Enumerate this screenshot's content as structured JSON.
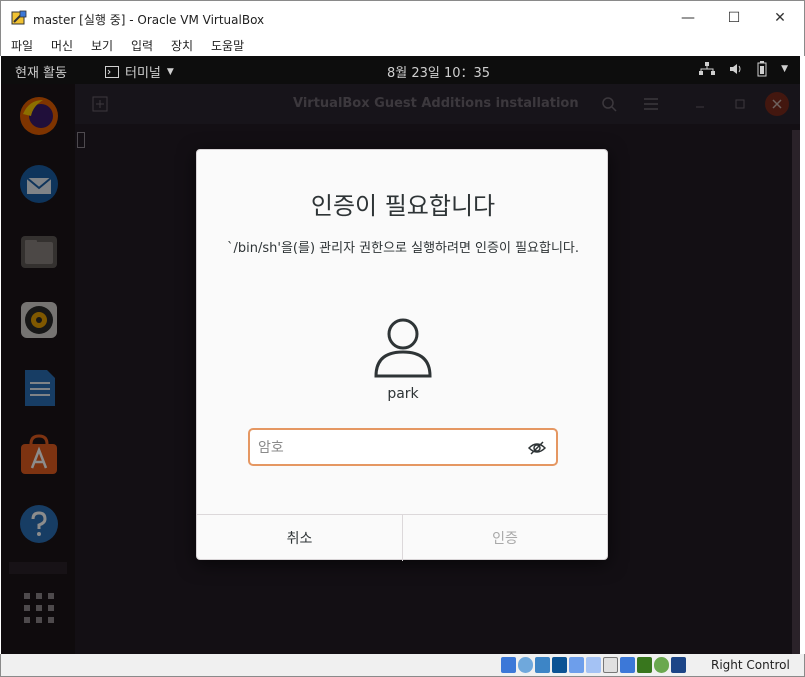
{
  "host": {
    "title": "master [실행 중] - Oracle VM VirtualBox",
    "menu": [
      "파일",
      "머신",
      "보기",
      "입력",
      "장치",
      "도움말"
    ],
    "minimize_glyph": "—",
    "maximize_glyph": "☐",
    "close_glyph": "✕",
    "statusbar": {
      "host_key": "Right Control",
      "icons": [
        "hdd-icon",
        "optical-icon",
        "audio-icon",
        "network-icon",
        "usb-icon",
        "shared-folder-icon",
        "display-icon",
        "recording-icon",
        "cpu-icon",
        "mouse-integration-icon",
        "keyboard-icon"
      ]
    }
  },
  "gnome": {
    "activities": "현재 활동",
    "app_menu": "터미널",
    "clock": "8월 23일 10：35"
  },
  "terminal": {
    "title": "VirtualBox Guest Additions installation"
  },
  "dock": {
    "items": [
      "firefox-icon",
      "thunderbird-icon",
      "files-icon",
      "rhythmbox-icon",
      "libreoffice-writer-icon",
      "software-icon",
      "help-icon",
      "show-apps-icon"
    ]
  },
  "auth": {
    "title": "인증이 필요합니다",
    "message": "`/bin/sh'을(를) 관리자 권한으로 실행하려면 인증이 필요합니다.",
    "username": "park",
    "password_placeholder": "암호",
    "cancel_label": "취소",
    "authenticate_label": "인증"
  },
  "colors": {
    "focus_border": "#e59762",
    "dialog_bg": "#fafafa",
    "disabled_text": "#a9a9a9"
  }
}
